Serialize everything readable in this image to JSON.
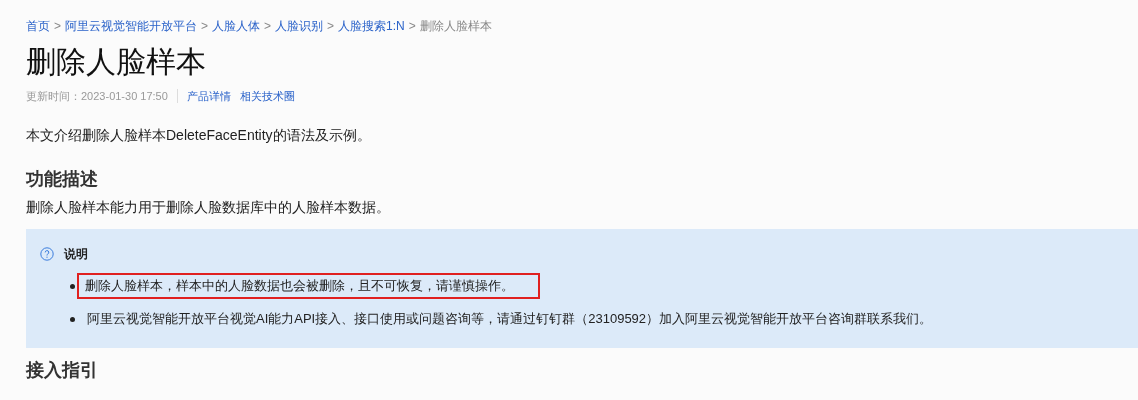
{
  "breadcrumb": [
    {
      "label": "首页",
      "link": true
    },
    {
      "label": "阿里云视觉智能开放平台",
      "link": true
    },
    {
      "label": "人脸人体",
      "link": true
    },
    {
      "label": "人脸识别",
      "link": true
    },
    {
      "label": "人脸搜索1:N",
      "link": true
    },
    {
      "label": "删除人脸样本",
      "link": false
    }
  ],
  "breadcrumb_separator": ">",
  "title": "删除人脸样本",
  "meta": {
    "updated": "更新时间：2023-01-30 17:50",
    "links": [
      "产品详情",
      "相关技术圈"
    ]
  },
  "intro": "本文介绍删除人脸样本DeleteFaceEntity的语法及示例。",
  "sections": [
    {
      "heading": "功能描述",
      "text": "删除人脸样本能力用于删除人脸数据库中的人脸样本数据。"
    }
  ],
  "note": {
    "title": "说明",
    "items": [
      {
        "text": "删除人脸样本，样本中的人脸数据也会被删除，且不可恢复，请谨慎操作。",
        "highlighted": true
      },
      {
        "text": "阿里云视觉智能开放平台视觉AI能力API接入、接口使用或问题咨询等，请通过钉钉群（23109592）加入阿里云视觉智能开放平台咨询群联系我们。",
        "highlighted": false
      }
    ]
  },
  "next_heading": "接入指引"
}
